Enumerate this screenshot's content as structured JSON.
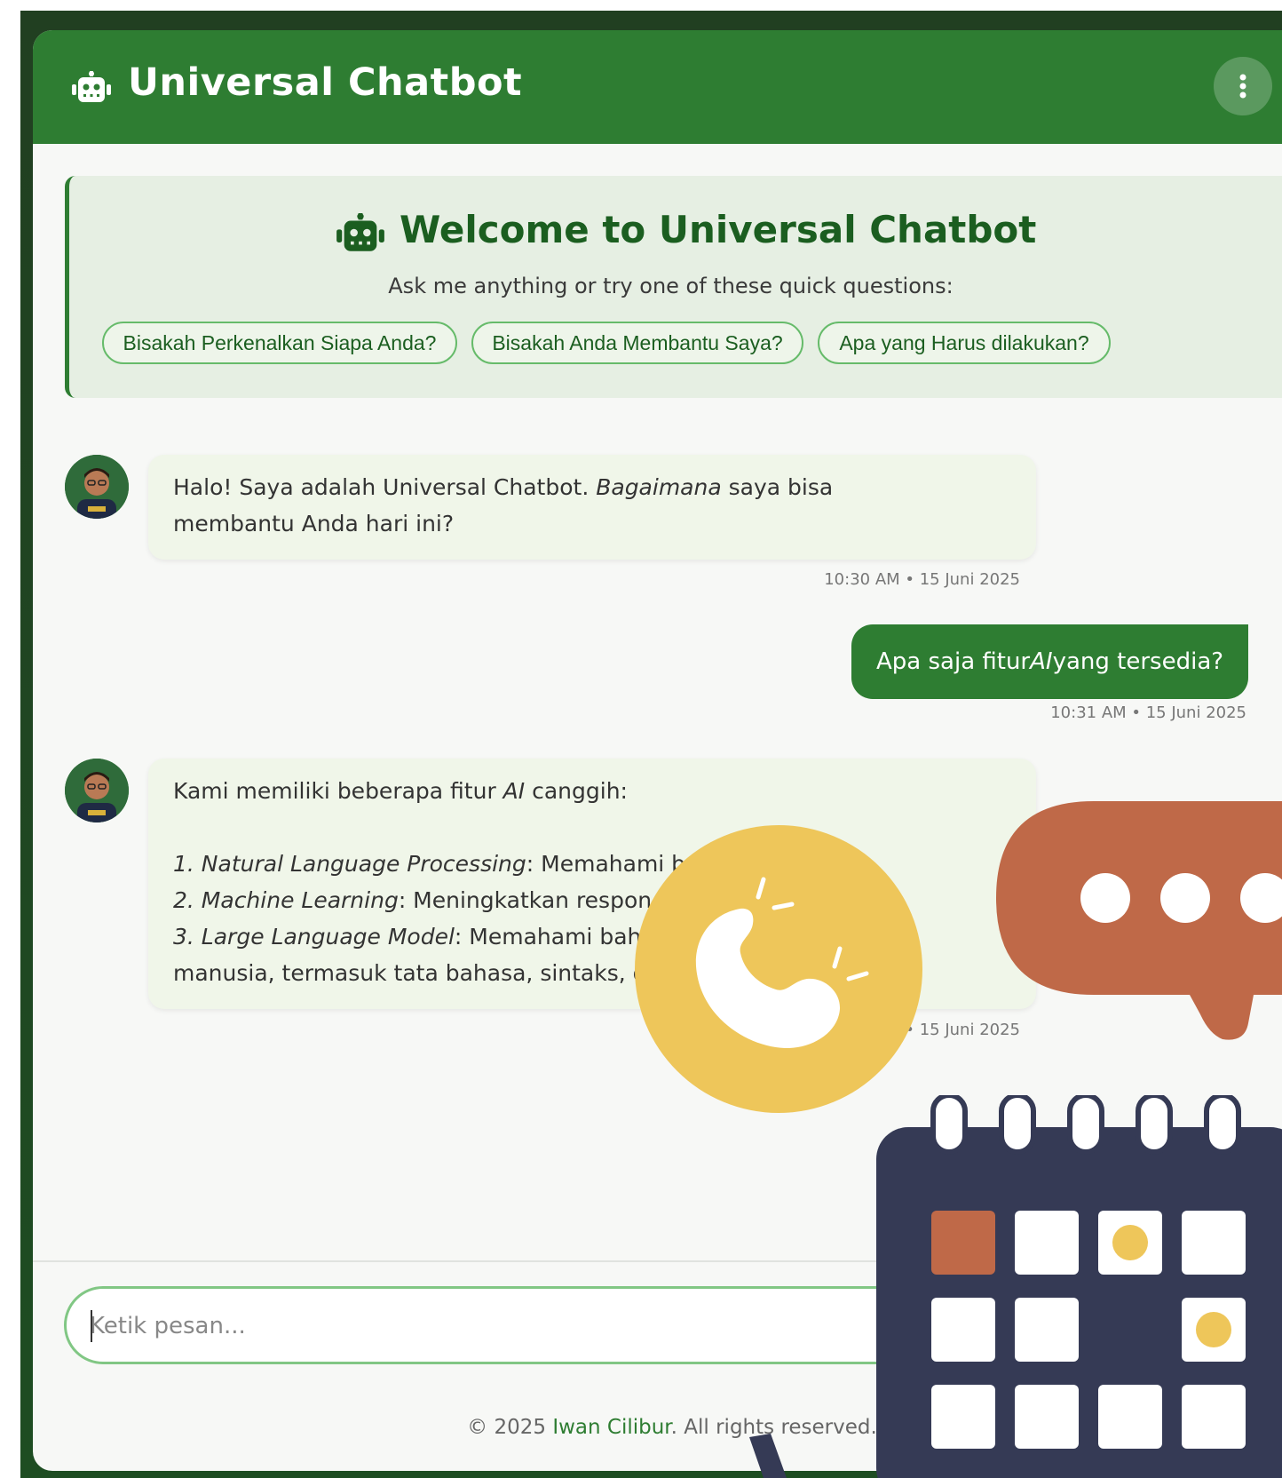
{
  "app": {
    "title": "Universal Chatbot"
  },
  "welcome": {
    "title": "Welcome to Universal Chatbot",
    "subtitle": "Ask me anything or try one of these quick questions:",
    "quick_questions": [
      "Bisakah Perkenalkan Siapa Anda?",
      "Bisakah Anda Membantu Saya?",
      "Apa yang Harus dilakukan?"
    ]
  },
  "messages": [
    {
      "sender": "bot",
      "text_before": "Halo! Saya adalah Universal Chatbot. ",
      "text_italic": "Bagaimana",
      "text_after": " saya bisa",
      "text_line2": "membantu Anda hari ini?",
      "timestamp": "10:30 AM • 15 Juni 2025"
    },
    {
      "sender": "user",
      "text_before": "Apa saja fitur ",
      "text_italic": "AI",
      "text_after": " yang tersedia?",
      "timestamp": "10:31 AM • 15 Juni 2025"
    },
    {
      "sender": "bot",
      "intro_before": "Kami memiliki beberapa fitur ",
      "intro_italic": "AI",
      "intro_after": " canggih:",
      "items": [
        {
          "italic": "1. Natural Language Processing",
          "text": ": Memahami bahasa alami"
        },
        {
          "italic": "2. Machine Learning",
          "text": ": Meningkatkan respon dari waktu ke waktu"
        },
        {
          "italic": "3. Large Language Model",
          "text": ": Memahami bahasa manusia"
        }
      ],
      "text_line_last": "manusia, termasuk tata bahasa, sintaks, dan konteks",
      "timestamp": "10:32 AM • 15 Juni 2025"
    }
  ],
  "input": {
    "placeholder": "Ketik pesan..."
  },
  "footer": {
    "copyright": "© 2025 ",
    "name": "Iwan Cilibur",
    "rights": ". All rights reserved."
  },
  "colors": {
    "primary": "#2e7d32",
    "primary_dark": "#1b5e20",
    "bot_bubble": "#f0f6e9",
    "accent_yellow": "#eec65a",
    "accent_terracotta": "#bf6948",
    "calendar_navy": "#353a55"
  },
  "icons": {
    "header": "robot-icon",
    "menu": "vertical-dots-icon",
    "overlay_phone": "phone-icon",
    "overlay_chat": "chat-bubble-icon",
    "overlay_calendar": "calendar-icon"
  }
}
